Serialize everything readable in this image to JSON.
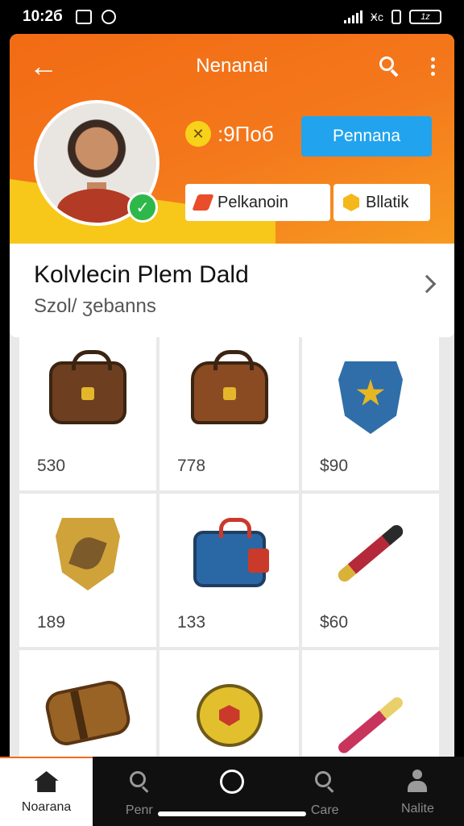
{
  "status_bar": {
    "time": "10:2б",
    "signal_text": "Ӿс",
    "battery": "1z"
  },
  "header": {
    "title": "Nenanai",
    "coins": ":9Поб",
    "primary_button": "Pennana",
    "chip_1": "Pelkanoin",
    "chip_2": "Bllatik"
  },
  "info_card": {
    "title": "Kolvlecin Plem Dald",
    "subtitle": "Szоl/ ӡebanns"
  },
  "grid": {
    "items": [
      {
        "name": "leather-bag",
        "price": "530"
      },
      {
        "name": "brown-satchel",
        "price": "778"
      },
      {
        "name": "blue-shield",
        "price": "$90"
      },
      {
        "name": "gold-shield",
        "price": "189"
      },
      {
        "name": "blue-case",
        "price": "133"
      },
      {
        "name": "dark-wand",
        "price": "$60"
      },
      {
        "name": "leather-roll",
        "price": ""
      },
      {
        "name": "gold-pouch",
        "price": ""
      },
      {
        "name": "pink-wand",
        "price": ""
      }
    ]
  },
  "bottom_nav": {
    "items": [
      {
        "label": "Noarana",
        "icon": "home-icon"
      },
      {
        "label": "Penr",
        "icon": "search-icon"
      },
      {
        "label": "",
        "icon": "circle-icon"
      },
      {
        "label": "Сare",
        "icon": "search-icon"
      },
      {
        "label": "Nalite",
        "icon": "person-icon"
      }
    ]
  },
  "colors": {
    "header_orange": "#f26b14",
    "accent_blue": "#22a3ee",
    "verified_green": "#2fb84a"
  }
}
